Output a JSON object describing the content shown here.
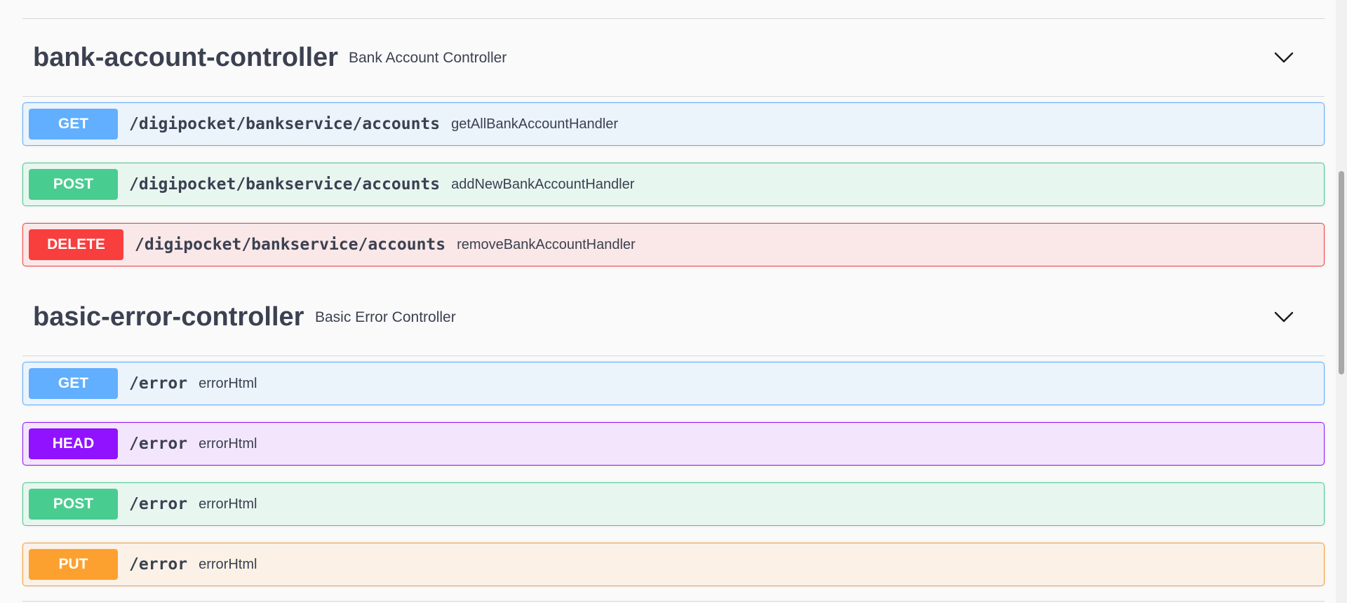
{
  "sections": [
    {
      "name": "bank-account-controller",
      "description": "Bank Account Controller",
      "operations": [
        {
          "method": "GET",
          "path": "/digipocket/bankservice/accounts",
          "summary": "getAllBankAccountHandler"
        },
        {
          "method": "POST",
          "path": "/digipocket/bankservice/accounts",
          "summary": "addNewBankAccountHandler"
        },
        {
          "method": "DELETE",
          "path": "/digipocket/bankservice/accounts",
          "summary": "removeBankAccountHandler"
        }
      ]
    },
    {
      "name": "basic-error-controller",
      "description": "Basic Error Controller",
      "operations": [
        {
          "method": "GET",
          "path": "/error",
          "summary": "errorHtml"
        },
        {
          "method": "HEAD",
          "path": "/error",
          "summary": "errorHtml"
        },
        {
          "method": "POST",
          "path": "/error",
          "summary": "errorHtml"
        },
        {
          "method": "PUT",
          "path": "/error",
          "summary": "errorHtml"
        }
      ]
    }
  ],
  "method_colors": {
    "GET": "#61affe",
    "POST": "#49cc90",
    "DELETE": "#f93e3e",
    "HEAD": "#9012fe",
    "PUT": "#fca130"
  },
  "icons": {
    "section_toggle": "chevron-down-icon"
  }
}
